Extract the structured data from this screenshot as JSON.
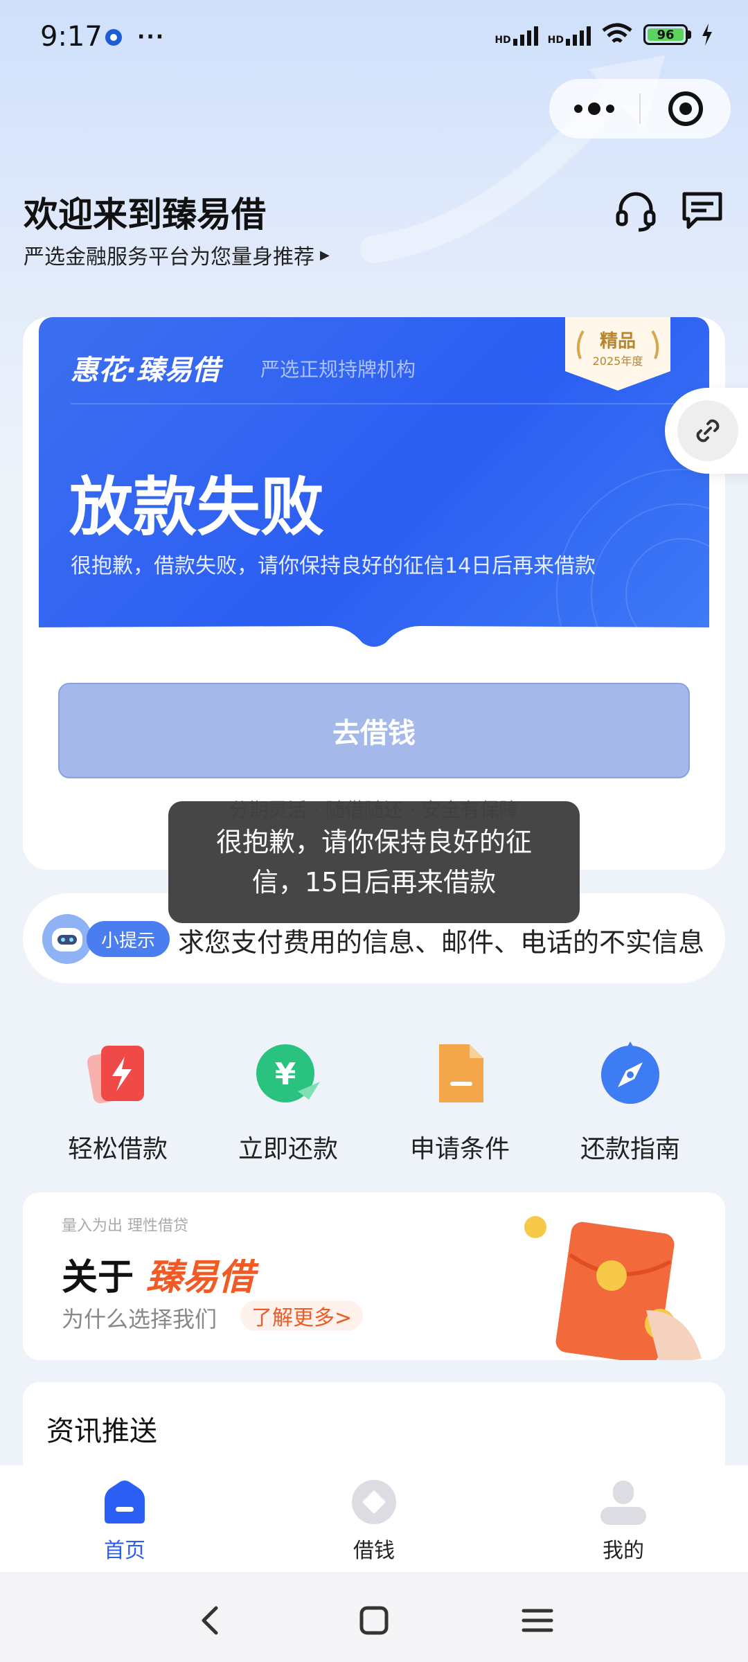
{
  "status_bar": {
    "time": "9:17",
    "signal1": "HD",
    "signal2": "HD",
    "battery": "96"
  },
  "header": {
    "title": "欢迎来到臻易借",
    "subtitle": "严选金融服务平台为您量身推荐",
    "icons": [
      "headset-icon",
      "message-icon"
    ]
  },
  "loan_panel": {
    "brand": "惠花·臻易借",
    "tag": "严选正规持牌机构",
    "badge_title": "精品",
    "badge_year": "2025年度",
    "status_title": "放款失败",
    "status_desc": "很抱歉，借款失败，请你保持良好的征信14日后再来借款",
    "button_label": "去借钱",
    "under_text": "分期灵活 · 随借随还 · 安全有保障"
  },
  "toast": {
    "message": "很抱歉，请你保持良好的征信，15日后再来借款"
  },
  "tip": {
    "pill": "小提示",
    "text": "求您支付费用的信息、邮件、电话的不实信息"
  },
  "quick_entries": [
    {
      "label": "轻松借款",
      "icon": "lightning-icon",
      "color": "#ef4a48"
    },
    {
      "label": "立即还款",
      "icon": "yuan-icon",
      "color": "#29c27f"
    },
    {
      "label": "申请条件",
      "icon": "document-icon",
      "color": "#f3a74a"
    },
    {
      "label": "还款指南",
      "icon": "compass-icon",
      "color": "#3d7cf2"
    }
  ],
  "about": {
    "small": "量入为出 理性借贷",
    "prefix": "关于",
    "brand": "臻易借",
    "sub": "为什么选择我们",
    "link": "了解更多>"
  },
  "news": {
    "title": "资讯推送"
  },
  "tabs": [
    {
      "label": "首页",
      "active": true
    },
    {
      "label": "借钱",
      "active": false
    },
    {
      "label": "我的",
      "active": false
    }
  ],
  "colors": {
    "primary": "#2b5ef2",
    "accent_orange": "#f05a24",
    "button_disabled": "#a4b8ea"
  }
}
